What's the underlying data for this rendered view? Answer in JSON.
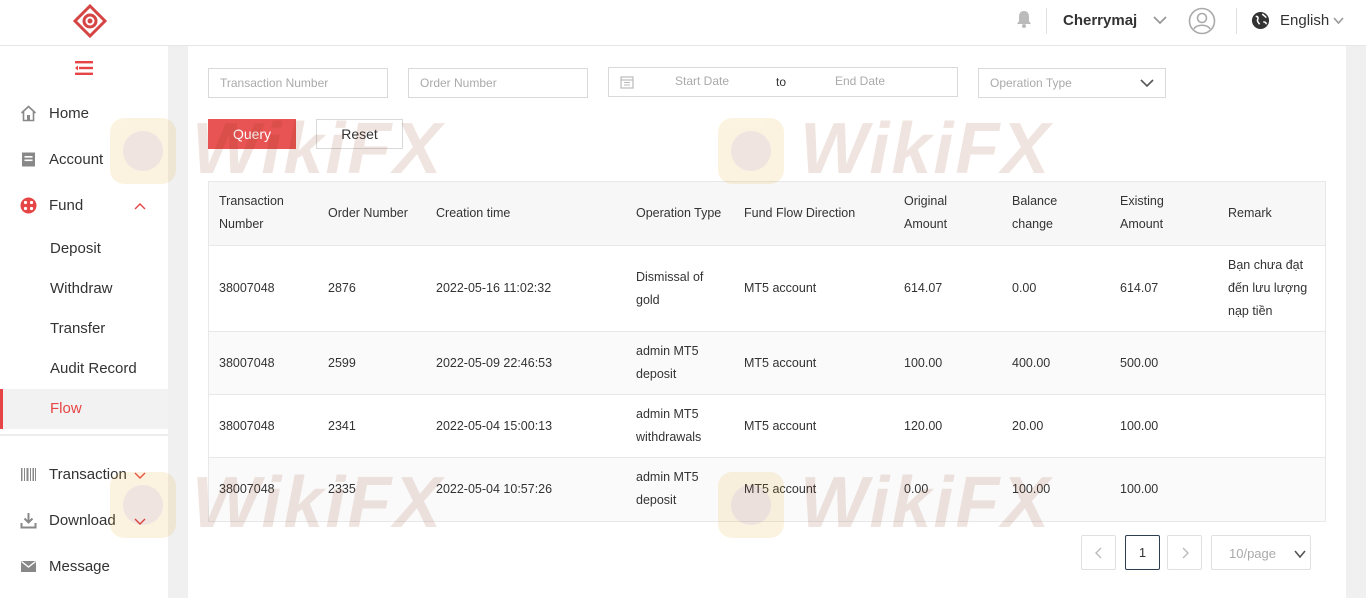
{
  "header": {
    "logo_icon": "company-logo",
    "username": "Cherrymaj",
    "language": "English"
  },
  "sidebar": {
    "items": [
      {
        "label": "Home",
        "icon": "home-icon"
      },
      {
        "label": "Account",
        "icon": "account-icon"
      },
      {
        "label": "Fund",
        "icon": "fund-icon"
      }
    ],
    "fund_sub": [
      {
        "label": "Deposit"
      },
      {
        "label": "Withdraw"
      },
      {
        "label": "Transfer"
      },
      {
        "label": "Audit Record"
      },
      {
        "label": "Flow"
      }
    ],
    "bottom_items": [
      {
        "label": "Transaction",
        "icon": "barcode-icon"
      },
      {
        "label": "Download",
        "icon": "download-icon"
      },
      {
        "label": "Message",
        "icon": "message-icon"
      }
    ],
    "active_color": "#e64545"
  },
  "filters": {
    "transaction_number_placeholder": "Transaction Number",
    "order_number_placeholder": "Order Number",
    "start_date_placeholder": "Start Date",
    "date_separator": "to",
    "end_date_placeholder": "End Date",
    "operation_type_placeholder": "Operation Type",
    "query_label": "Query",
    "reset_label": "Reset",
    "accent": "#e85353"
  },
  "table": {
    "headers": {
      "transaction_number_1": "Transaction",
      "transaction_number_2": "Number",
      "order_number": "Order Number",
      "creation_time": "Creation time",
      "operation_type": "Operation Type",
      "fund_flow_direction": "Fund Flow Direction",
      "original_amount_1": "Original",
      "original_amount_2": "Amount",
      "balance_change_1": "Balance",
      "balance_change_2": "change",
      "existing_amount_1": "Existing",
      "existing_amount_2": "Amount",
      "remark": "Remark"
    },
    "rows": [
      {
        "transaction_number": "38007048",
        "order_number": "2876",
        "creation_time": "2022-05-16 11:02:32",
        "op_1": "Dismissal of",
        "op_2": "gold",
        "direction": "MT5 account",
        "original": "614.07",
        "change": "0.00",
        "existing": "614.07",
        "remark_1": "Bạn chưa đạt",
        "remark_2": "đến lưu lượng",
        "remark_3": "nạp tiền"
      },
      {
        "transaction_number": "38007048",
        "order_number": "2599",
        "creation_time": "2022-05-09 22:46:53",
        "op_1": "admin MT5",
        "op_2": "deposit",
        "direction": "MT5 account",
        "original": "100.00",
        "change": "400.00",
        "existing": "500.00"
      },
      {
        "transaction_number": "38007048",
        "order_number": "2341",
        "creation_time": "2022-05-04 15:00:13",
        "op_1": "admin MT5",
        "op_2": "withdrawals",
        "direction": "MT5 account",
        "original": "120.00",
        "change": "20.00",
        "existing": "100.00"
      },
      {
        "transaction_number": "38007048",
        "order_number": "2335",
        "creation_time": "2022-05-04 10:57:26",
        "op_1": "admin MT5",
        "op_2": "deposit",
        "direction": "MT5 account",
        "original": "0.00",
        "change": "100.00",
        "existing": "100.00"
      }
    ]
  },
  "pagination": {
    "current_page": "1",
    "page_size": "10/page"
  },
  "watermark": {
    "text": "WikiFX"
  }
}
